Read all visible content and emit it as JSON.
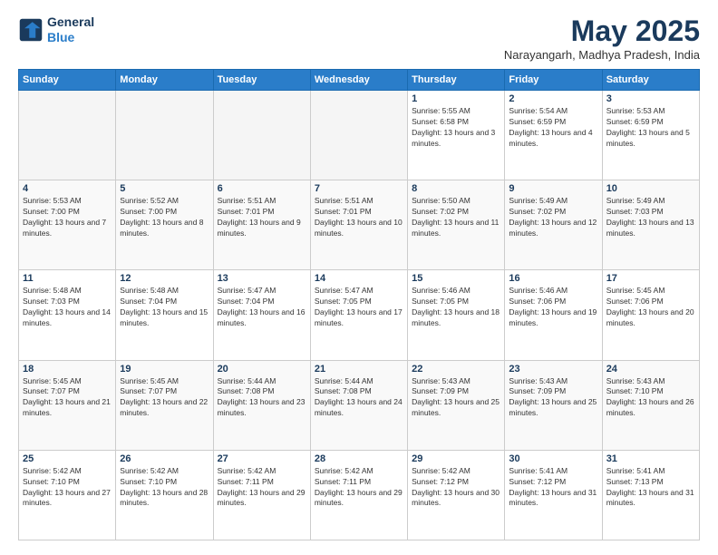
{
  "header": {
    "logo_line1": "General",
    "logo_line2": "Blue",
    "month_title": "May 2025",
    "location": "Narayangarh, Madhya Pradesh, India"
  },
  "weekdays": [
    "Sunday",
    "Monday",
    "Tuesday",
    "Wednesday",
    "Thursday",
    "Friday",
    "Saturday"
  ],
  "weeks": [
    [
      {
        "day": "",
        "empty": true
      },
      {
        "day": "",
        "empty": true
      },
      {
        "day": "",
        "empty": true
      },
      {
        "day": "",
        "empty": true
      },
      {
        "day": "1",
        "sunrise": "5:55 AM",
        "sunset": "6:58 PM",
        "daylight": "13 hours and 3 minutes."
      },
      {
        "day": "2",
        "sunrise": "5:54 AM",
        "sunset": "6:59 PM",
        "daylight": "13 hours and 4 minutes."
      },
      {
        "day": "3",
        "sunrise": "5:53 AM",
        "sunset": "6:59 PM",
        "daylight": "13 hours and 5 minutes."
      }
    ],
    [
      {
        "day": "4",
        "sunrise": "5:53 AM",
        "sunset": "7:00 PM",
        "daylight": "13 hours and 7 minutes."
      },
      {
        "day": "5",
        "sunrise": "5:52 AM",
        "sunset": "7:00 PM",
        "daylight": "13 hours and 8 minutes."
      },
      {
        "day": "6",
        "sunrise": "5:51 AM",
        "sunset": "7:01 PM",
        "daylight": "13 hours and 9 minutes."
      },
      {
        "day": "7",
        "sunrise": "5:51 AM",
        "sunset": "7:01 PM",
        "daylight": "13 hours and 10 minutes."
      },
      {
        "day": "8",
        "sunrise": "5:50 AM",
        "sunset": "7:02 PM",
        "daylight": "13 hours and 11 minutes."
      },
      {
        "day": "9",
        "sunrise": "5:49 AM",
        "sunset": "7:02 PM",
        "daylight": "13 hours and 12 minutes."
      },
      {
        "day": "10",
        "sunrise": "5:49 AM",
        "sunset": "7:03 PM",
        "daylight": "13 hours and 13 minutes."
      }
    ],
    [
      {
        "day": "11",
        "sunrise": "5:48 AM",
        "sunset": "7:03 PM",
        "daylight": "13 hours and 14 minutes."
      },
      {
        "day": "12",
        "sunrise": "5:48 AM",
        "sunset": "7:04 PM",
        "daylight": "13 hours and 15 minutes."
      },
      {
        "day": "13",
        "sunrise": "5:47 AM",
        "sunset": "7:04 PM",
        "daylight": "13 hours and 16 minutes."
      },
      {
        "day": "14",
        "sunrise": "5:47 AM",
        "sunset": "7:05 PM",
        "daylight": "13 hours and 17 minutes."
      },
      {
        "day": "15",
        "sunrise": "5:46 AM",
        "sunset": "7:05 PM",
        "daylight": "13 hours and 18 minutes."
      },
      {
        "day": "16",
        "sunrise": "5:46 AM",
        "sunset": "7:06 PM",
        "daylight": "13 hours and 19 minutes."
      },
      {
        "day": "17",
        "sunrise": "5:45 AM",
        "sunset": "7:06 PM",
        "daylight": "13 hours and 20 minutes."
      }
    ],
    [
      {
        "day": "18",
        "sunrise": "5:45 AM",
        "sunset": "7:07 PM",
        "daylight": "13 hours and 21 minutes."
      },
      {
        "day": "19",
        "sunrise": "5:45 AM",
        "sunset": "7:07 PM",
        "daylight": "13 hours and 22 minutes."
      },
      {
        "day": "20",
        "sunrise": "5:44 AM",
        "sunset": "7:08 PM",
        "daylight": "13 hours and 23 minutes."
      },
      {
        "day": "21",
        "sunrise": "5:44 AM",
        "sunset": "7:08 PM",
        "daylight": "13 hours and 24 minutes."
      },
      {
        "day": "22",
        "sunrise": "5:43 AM",
        "sunset": "7:09 PM",
        "daylight": "13 hours and 25 minutes."
      },
      {
        "day": "23",
        "sunrise": "5:43 AM",
        "sunset": "7:09 PM",
        "daylight": "13 hours and 25 minutes."
      },
      {
        "day": "24",
        "sunrise": "5:43 AM",
        "sunset": "7:10 PM",
        "daylight": "13 hours and 26 minutes."
      }
    ],
    [
      {
        "day": "25",
        "sunrise": "5:42 AM",
        "sunset": "7:10 PM",
        "daylight": "13 hours and 27 minutes."
      },
      {
        "day": "26",
        "sunrise": "5:42 AM",
        "sunset": "7:10 PM",
        "daylight": "13 hours and 28 minutes."
      },
      {
        "day": "27",
        "sunrise": "5:42 AM",
        "sunset": "7:11 PM",
        "daylight": "13 hours and 29 minutes."
      },
      {
        "day": "28",
        "sunrise": "5:42 AM",
        "sunset": "7:11 PM",
        "daylight": "13 hours and 29 minutes."
      },
      {
        "day": "29",
        "sunrise": "5:42 AM",
        "sunset": "7:12 PM",
        "daylight": "13 hours and 30 minutes."
      },
      {
        "day": "30",
        "sunrise": "5:41 AM",
        "sunset": "7:12 PM",
        "daylight": "13 hours and 31 minutes."
      },
      {
        "day": "31",
        "sunrise": "5:41 AM",
        "sunset": "7:13 PM",
        "daylight": "13 hours and 31 minutes."
      }
    ]
  ]
}
